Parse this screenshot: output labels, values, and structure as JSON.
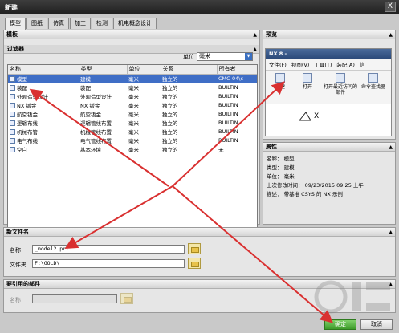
{
  "window": {
    "title": "新建",
    "close_label": "X"
  },
  "tabs": [
    "模型",
    "图纸",
    "仿真",
    "加工",
    "检测",
    "机电概念设计"
  ],
  "template_panel": {
    "title": "模板",
    "filter_title": "过滤器",
    "unit_label": "单位",
    "unit_value": "毫米",
    "columns": [
      "名称",
      "类型",
      "单位",
      "关系",
      "所有者"
    ],
    "rows": [
      {
        "name": "模型",
        "type": "建模",
        "unit": "毫米",
        "relation": "独立的",
        "owner": "CMC-04\\c",
        "icon": "model-icon"
      },
      {
        "name": "装配",
        "type": "装配",
        "unit": "毫米",
        "relation": "独立的",
        "owner": "BUILTIN",
        "icon": "assembly-icon"
      },
      {
        "name": "外观造型设计",
        "type": "外观造型设计",
        "unit": "毫米",
        "relation": "独立的",
        "owner": "BUILTIN",
        "icon": "shape-studio-icon"
      },
      {
        "name": "NX 钣金",
        "type": "NX 钣金",
        "unit": "毫米",
        "relation": "独立的",
        "owner": "BUILTIN",
        "icon": "sheet-metal-icon"
      },
      {
        "name": "航空钣金",
        "type": "航空钣金",
        "unit": "毫米",
        "relation": "独立的",
        "owner": "BUILTIN",
        "icon": "aero-sheet-metal-icon"
      },
      {
        "name": "逻辑布线",
        "type": "逻辑管线布置",
        "unit": "毫米",
        "relation": "独立的",
        "owner": "BUILTIN",
        "icon": "logical-routing-icon"
      },
      {
        "name": "机械布管",
        "type": "机械管线布置",
        "unit": "毫米",
        "relation": "独立的",
        "owner": "BUILTIN",
        "icon": "mechanical-routing-icon"
      },
      {
        "name": "电气布线",
        "type": "电气管线布置",
        "unit": "毫米",
        "relation": "独立的",
        "owner": "BUILTIN",
        "icon": "electrical-routing-icon"
      },
      {
        "name": "空白",
        "type": "基本环境",
        "unit": "毫米",
        "relation": "独立的",
        "owner": "无",
        "icon": "blank-icon"
      }
    ]
  },
  "preview_panel": {
    "title": "预览",
    "nx_title": "NX 8 -",
    "menu": [
      "文件(F)",
      "视图(V)",
      "工具(T)",
      "装配(A)",
      "信"
    ],
    "tools": [
      "新建",
      "打开",
      "打开最近访问的部件",
      "命令查找器"
    ],
    "axis_label": "X"
  },
  "properties_panel": {
    "title": "属性",
    "lines": [
      "名称： 模型",
      "类型： 建模",
      "单位： 毫米",
      "上次修改时间： 09/23/2015 09:25 上午",
      "描述： 带基准 CSYS 的 NX 示例"
    ]
  },
  "new_file": {
    "title": "新文件名",
    "name_label": "名称",
    "name_value": "_model2.prt",
    "folder_label": "文件夹",
    "folder_value": "F:\\GOLD\\"
  },
  "ref_parts": {
    "title": "要引用的部件",
    "name_label": "名称"
  },
  "buttons": {
    "ok": "确定",
    "cancel": "取消"
  },
  "colors": {
    "selection": "#3f6ec6",
    "annotation_arrow": "#d93030",
    "ok_button": "#4aa832"
  }
}
